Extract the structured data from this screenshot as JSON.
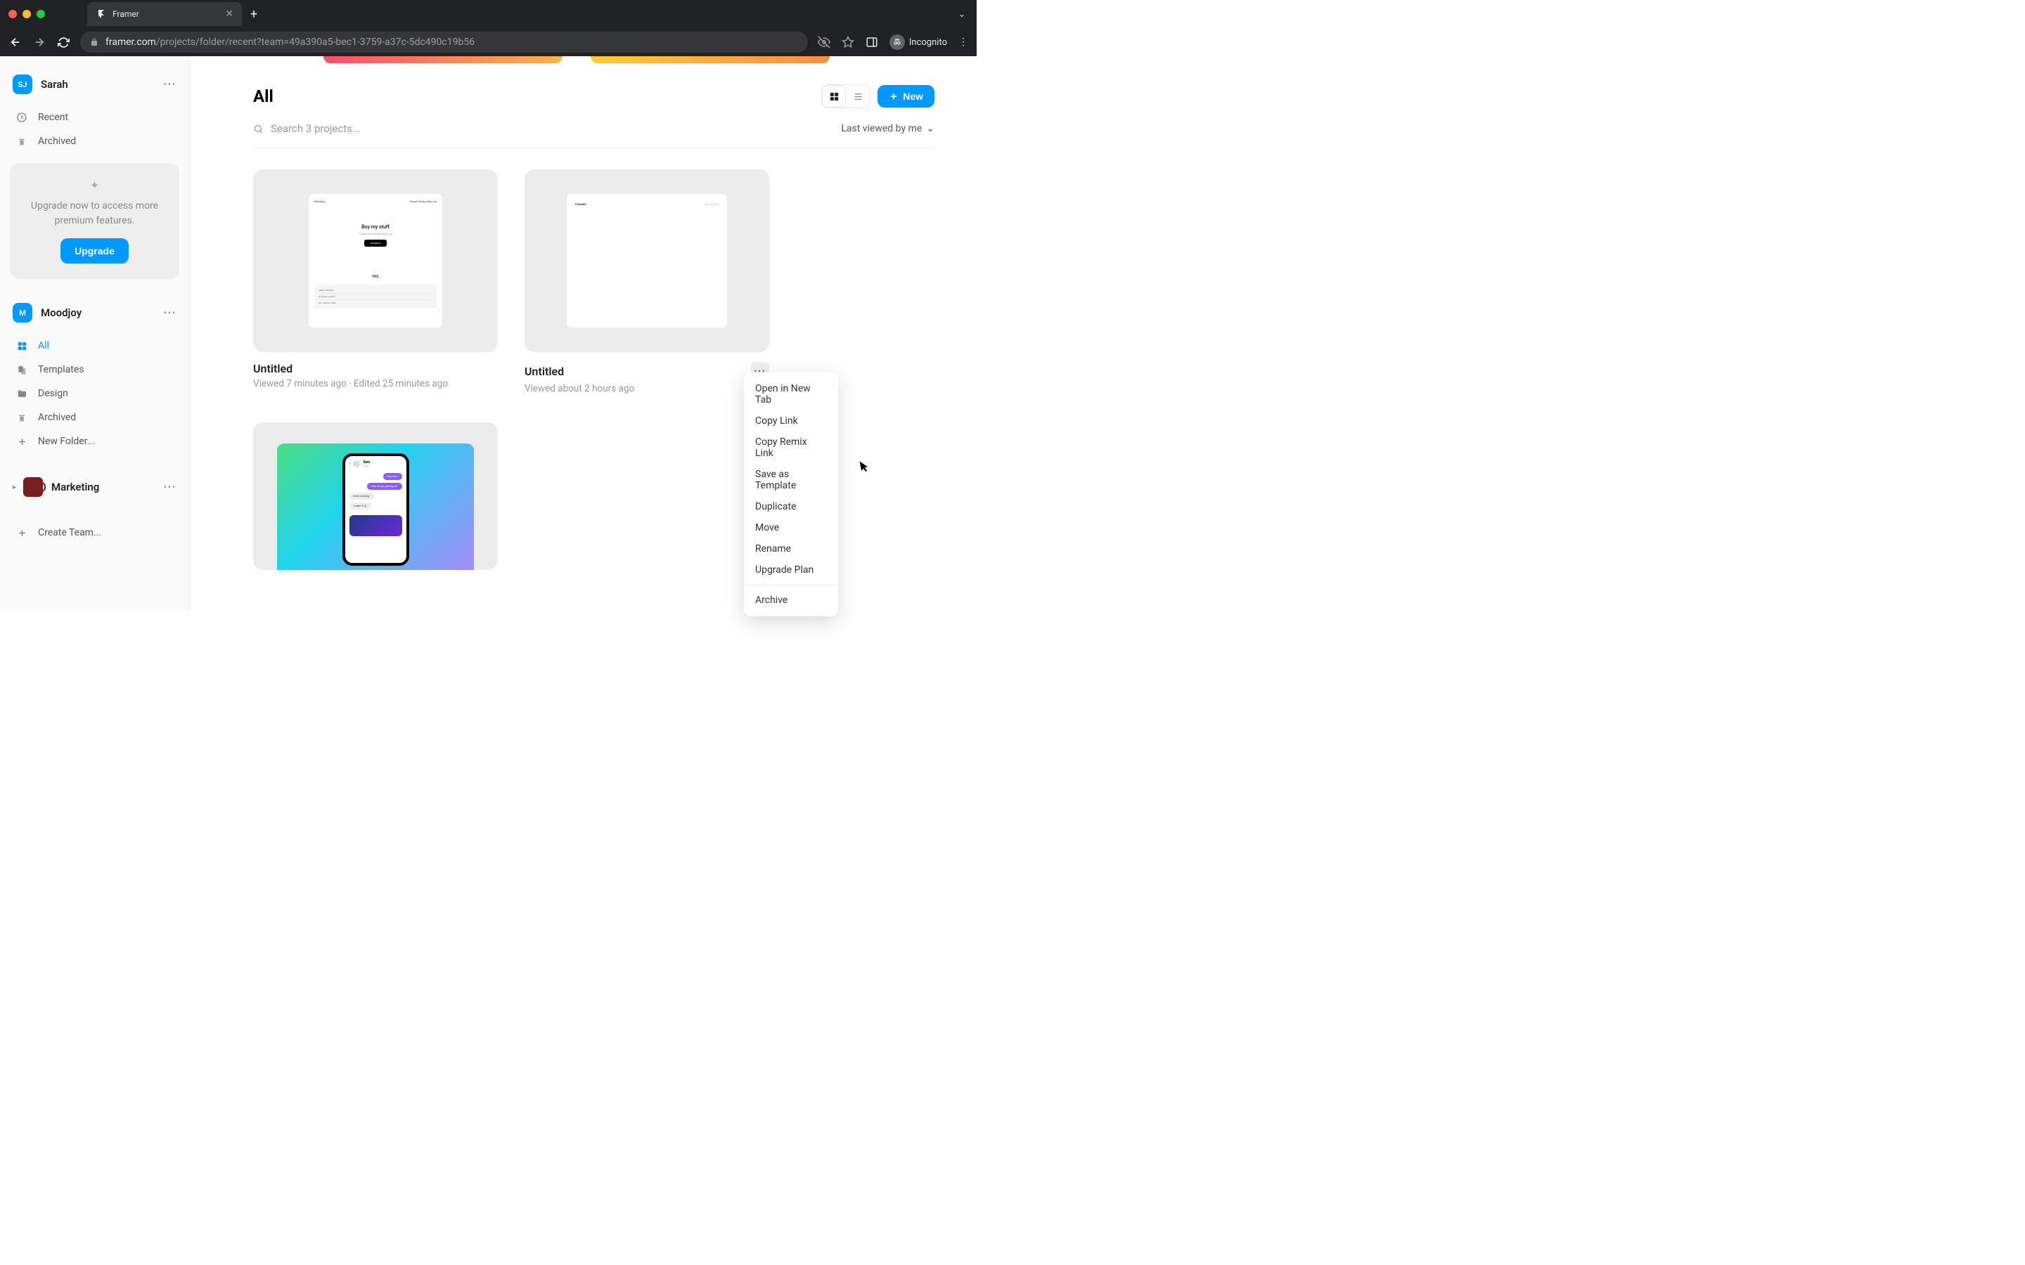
{
  "browser": {
    "tab_title": "Framer",
    "url_domain": "framer.com",
    "url_path": "/projects/folder/recent?team=49a390a5-bec1-3759-a37c-5dc490c19b56",
    "incognito_label": "Incognito"
  },
  "sidebar": {
    "user_section": {
      "avatar_initials": "SJ",
      "name": "Sarah",
      "items": [
        {
          "icon": "clock-icon",
          "label": "Recent"
        },
        {
          "icon": "archive-icon",
          "label": "Archived"
        }
      ]
    },
    "upgrade_card": {
      "text": "Upgrade now to access more premium features.",
      "button": "Upgrade"
    },
    "workspace1": {
      "avatar_initials": "M",
      "name": "Moodjoy",
      "items": [
        {
          "icon": "grid-icon",
          "label": "All",
          "active": true
        },
        {
          "icon": "templates-icon",
          "label": "Templates"
        },
        {
          "icon": "folder-icon",
          "label": "Design"
        },
        {
          "icon": "archive-icon",
          "label": "Archived"
        },
        {
          "icon": "plus-icon",
          "label": "New Folder..."
        }
      ]
    },
    "workspace2": {
      "name": "Marketing"
    },
    "create_team": "Create Team..."
  },
  "main": {
    "title": "All",
    "new_button": "New",
    "search_placeholder": "Search 3 projects...",
    "sort_label": "Last viewed by me",
    "projects": [
      {
        "title": "Untitled",
        "subtitle": "Viewed 7 minutes ago  ·  Edited 25 minutes ago",
        "preview": {
          "brand": "Moodjoy",
          "nav": "About   Pricing   Sign up",
          "hero_title": "Buy my stuff",
          "hero_sub": "Please buy things from me",
          "hero_cta": "Get Started",
          "faq_title": "FAQ",
          "faq_items": [
            "What is Framer?",
            "Is it easy to learn?",
            "Do I need to code?"
          ]
        }
      },
      {
        "title": "Untitled",
        "subtitle": "Viewed about 2 hours ago",
        "preview": {
          "brand": "FRAMER",
          "nav": "About   Blog"
        }
      },
      {
        "preview": {
          "contact_name": "Sam",
          "contact_status": "online",
          "messages": [
            {
              "text": "Hey Sam!",
              "kind": "purple"
            },
            {
              "text": "How are you getting on?",
              "kind": "purple"
            },
            {
              "text": "Good morning!",
              "kind": "grey"
            },
            {
              "text": "I made it! 🎉",
              "kind": "grey"
            }
          ]
        }
      }
    ]
  },
  "context_menu": {
    "items_a": [
      "Open in New Tab",
      "Copy Link",
      "Copy Remix Link",
      "Save as Template",
      "Duplicate",
      "Move",
      "Rename",
      "Upgrade Plan"
    ],
    "items_b": [
      "Archive"
    ]
  }
}
